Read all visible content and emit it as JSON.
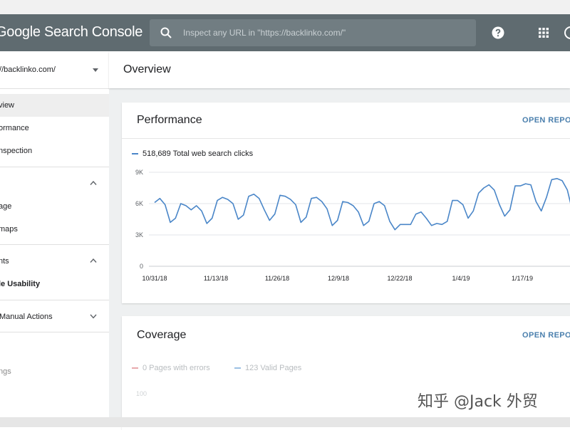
{
  "app": {
    "title": "Google Search Console"
  },
  "search": {
    "placeholder": "Inspect any URL in \"https://backlinko.com/\""
  },
  "sidebar": {
    "property": "://backlinko.com/",
    "items": [
      {
        "label": "view"
      },
      {
        "label": "ormance"
      },
      {
        "label": "nspection"
      },
      {
        "label": "age"
      },
      {
        "label": "maps"
      },
      {
        "label": "nts"
      },
      {
        "label": "le Usability"
      },
      {
        "label": "Manual Actions"
      },
      {
        "label": ""
      },
      {
        "label": "ngs"
      }
    ]
  },
  "main": {
    "page_title": "Overview"
  },
  "performance": {
    "title": "Performance",
    "open_report": "OPEN REPORT",
    "legend": "518,689 Total web search clicks",
    "colors": {
      "line": "#4a86c8",
      "grid": "#e3e6e8"
    }
  },
  "coverage": {
    "title": "Coverage",
    "open_report": "OPEN REPORT",
    "legend_errors": "0 Pages with errors",
    "legend_valid": "123 Valid Pages",
    "ytick": "100",
    "colors": {
      "errors": "#e8a9ac",
      "valid": "#9cc0e3"
    }
  },
  "watermark": "知乎 @Jack 外贸",
  "chart_data": {
    "type": "line",
    "series": [
      {
        "name": "518,689 Total web search clicks",
        "values": [
          6100,
          6500,
          5900,
          4200,
          4600,
          6000,
          5800,
          5400,
          5800,
          5300,
          4100,
          4600,
          6300,
          6600,
          6400,
          6000,
          4500,
          4900,
          6700,
          6900,
          6500,
          5400,
          4400,
          5000,
          6800,
          6700,
          6400,
          5900,
          4200,
          4700,
          6500,
          6600,
          6200,
          5500,
          3900,
          4400,
          6200,
          6100,
          5800,
          5200,
          3900,
          4300,
          6000,
          6200,
          5800,
          4300,
          3500,
          4000,
          4000,
          4000,
          5000,
          5200,
          4600,
          3900,
          4100,
          4000,
          4300,
          6300,
          6300,
          5900,
          4600,
          5300,
          7000,
          7500,
          7800,
          7300,
          5900,
          4800,
          5400,
          7700,
          7700,
          7900,
          7800,
          6200,
          5300,
          6600,
          8300,
          8400,
          8200,
          7300,
          5200,
          6200
        ]
      }
    ],
    "x_tick_labels": [
      "10/31/18",
      "11/13/18",
      "11/26/18",
      "12/9/18",
      "12/22/18",
      "1/4/19",
      "1/17/19"
    ],
    "y_tick_labels": [
      "0",
      "3K",
      "6K",
      "9K"
    ],
    "ylim": [
      0,
      9000
    ],
    "grid": true,
    "legend_position": "top-left"
  }
}
